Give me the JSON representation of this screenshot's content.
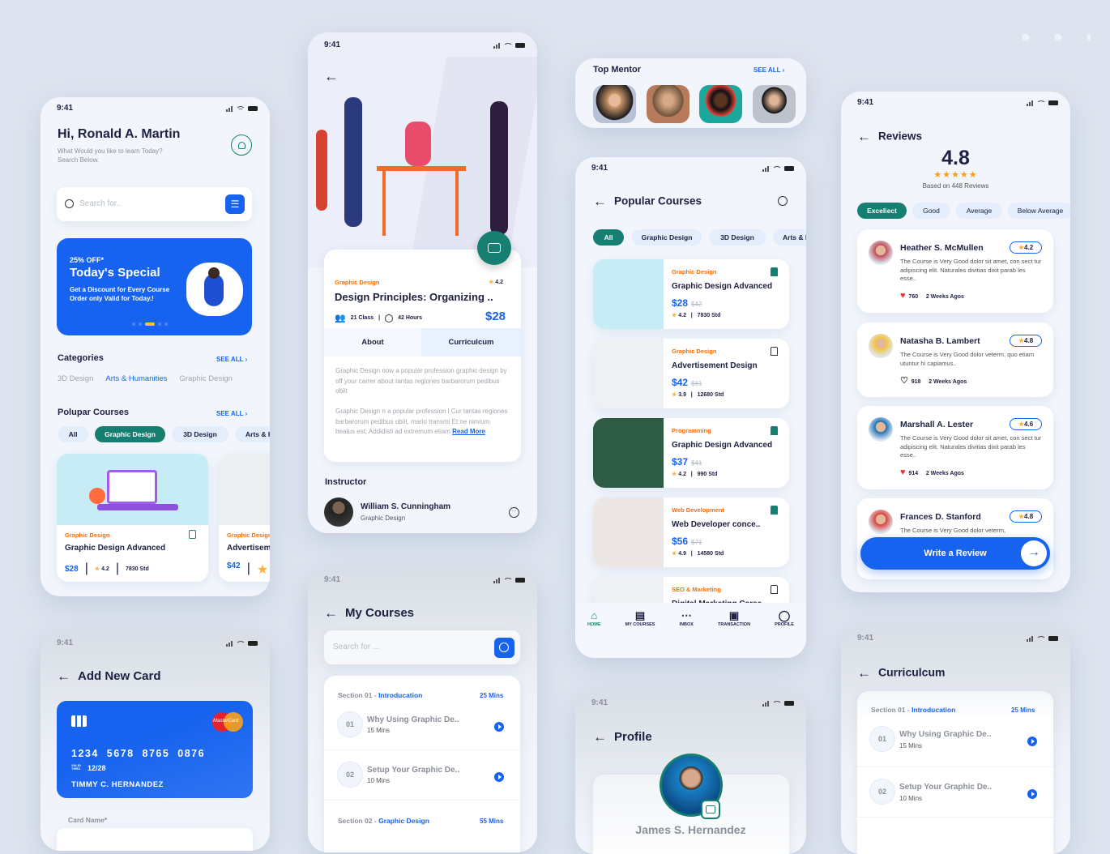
{
  "colors": {
    "primary": "#1763ef",
    "accent_green": "#167f71",
    "category_orange": "#ff6b00",
    "background": "#dde4ef",
    "star": "#fcb03b",
    "like_red": "#e8323c"
  },
  "status_time": "9:41",
  "home": {
    "greeting": "Hi, Ronald A. Martin",
    "subtitle_line1": "What Would you like to learn Today?",
    "subtitle_line2": "Search Below.",
    "search_placeholder": "Search for..",
    "promo": {
      "discount": "25% OFF*",
      "title": "Today's Special",
      "text": "Get a Discount for Every Course Order only Valid for Today.!"
    },
    "categories": {
      "title": "Categories",
      "see_all": "SEE ALL",
      "items": [
        "3D Design",
        "Arts & Humanities",
        "Graphic Design"
      ],
      "active": "Arts & Humanities"
    },
    "popular": {
      "title": "Polupar Courses",
      "see_all": "SEE ALL",
      "chips": [
        "All",
        "Graphic Design",
        "3D Design",
        "Arts & Humanities"
      ],
      "active_chip": "Graphic Design",
      "courses": [
        {
          "category": "Graphic Design",
          "title": "Graphic Design Advanced",
          "price": "$28",
          "rating": "4.2",
          "students": "7830 Std"
        },
        {
          "category": "Graphic Design",
          "title": "Advertisement Design",
          "price": "$42"
        }
      ]
    }
  },
  "add_card": {
    "title": "Add New Card",
    "number": "1234  5678  8765  0876",
    "valid_label_1": "VALID",
    "valid_label_2": "THRU",
    "expiry": "12/28",
    "holder": "TIMMY C. HERNANDEZ",
    "brand": "MasterCard",
    "field_label": "Card Name*"
  },
  "detail": {
    "category": "Graphic Design",
    "rating": "4.2",
    "title": "Design Principles: Organizing ..",
    "classes": "21 Class",
    "hours": "42 Hours",
    "price": "$28",
    "tabs": [
      "About",
      "Curriculcum"
    ],
    "about": [
      "Graphic Design now a popular profession graphic design by off your carrer about tantas regiones barbarorum pedibus obiit",
      "Graphic Design n a popular profession l Cur tantas regiones barbarorum pedibus obiit, mario transmi Et ne nimium beatus est; Addidisti ad extremum etiam"
    ],
    "read_more": "Read More",
    "instructor_heading": "Instructor",
    "instructor_name": "William S. Cunningham",
    "instructor_role": "Graphic Design"
  },
  "my_courses": {
    "title": "My Courses",
    "search_placeholder": "Search for ...",
    "sections": [
      {
        "label": "Section 01 - ",
        "name": "Introducation",
        "duration": "25 Mins",
        "lessons": [
          {
            "num": "01",
            "title": "Why Using Graphic De..",
            "duration": "15 Mins"
          },
          {
            "num": "02",
            "title": "Setup Your Graphic De..",
            "duration": "10 Mins"
          }
        ]
      },
      {
        "label": "Section 02 - ",
        "name": "Graphic Design",
        "duration": "55 Mins"
      }
    ]
  },
  "mentors": {
    "title": "Top Mentor",
    "see_all": "SEE ALL"
  },
  "popular_screen": {
    "title": "Popular Courses",
    "chips": [
      "All",
      "Graphic Design",
      "3D Design",
      "Arts & Humanities"
    ],
    "active_chip": "All",
    "courses": [
      {
        "category": "Graphic Design",
        "title": "Graphic Design Advanced",
        "price": "$28",
        "old_price": "$42",
        "rating": "4.2",
        "students": "7830 Std",
        "bookmarked": true
      },
      {
        "category": "Graphic Design",
        "title": "Advertisement Design",
        "price": "$42",
        "old_price": "$61",
        "rating": "3.9",
        "students": "12680 Std",
        "bookmarked": false
      },
      {
        "category": "Programming",
        "title": "Graphic Design Advanced",
        "price": "$37",
        "old_price": "$41",
        "rating": "4.2",
        "students": "990 Std",
        "bookmarked": true
      },
      {
        "category": "Web Development",
        "title": "Web Developer conce..",
        "price": "$56",
        "old_price": "$71",
        "rating": "4.9",
        "students": "14580 Std",
        "bookmarked": true
      },
      {
        "category": "SEO & Marketing",
        "title": "Digital Marketing Caree..",
        "bookmarked": false
      }
    ],
    "nav": [
      "HOME",
      "MY COURSES",
      "INBOX",
      "TRANSACTION",
      "PROFILE"
    ],
    "active_nav": "HOME"
  },
  "profile": {
    "title": "Profile",
    "name": "James S. Hernandez"
  },
  "reviews": {
    "title": "Reviews",
    "rating": "4.8",
    "stars": 4.8,
    "based_on": "Based on 448 Reviews",
    "filters": [
      "Excellect",
      "Good",
      "Average",
      "Below Average"
    ],
    "active_filter": "Excellect",
    "items": [
      {
        "name": "Heather S. McMullen",
        "rating": "4.2",
        "text": "The Course is Very Good dolor sit amet, con sect tur adipiscing elit. Naturales divitias dixit parab les esse..",
        "likes": "760",
        "time": "2 Weeks Agos",
        "liked": true
      },
      {
        "name": "Natasha B. Lambert",
        "rating": "4.8",
        "text": "The Course is Very Good dolor veterm, quo etiam utuntur hi capiamus..",
        "likes": "918",
        "time": "2 Weeks Agos",
        "liked": false
      },
      {
        "name": "Marshall A. Lester",
        "rating": "4.6",
        "text": "The Course is Very Good dolor sit amet, con sect tur adipiscing elit. Naturales divitias dixit parab les esse..",
        "likes": "914",
        "time": "2 Weeks Agos",
        "liked": true
      },
      {
        "name": "Frances D. Stanford",
        "rating": "4.8",
        "text": "The Course is Very Good dolor veterm,"
      }
    ],
    "write_button": "Write a Review"
  },
  "curriculum": {
    "title": "Curriculcum",
    "section": {
      "label": "Section 01 - ",
      "name": "Introducation",
      "duration": "25 Mins",
      "lessons": [
        {
          "num": "01",
          "title": "Why Using Graphic De..",
          "duration": "15 Mins"
        },
        {
          "num": "02",
          "title": "Setup Your Graphic De..",
          "duration": "10 Mins"
        }
      ]
    }
  }
}
